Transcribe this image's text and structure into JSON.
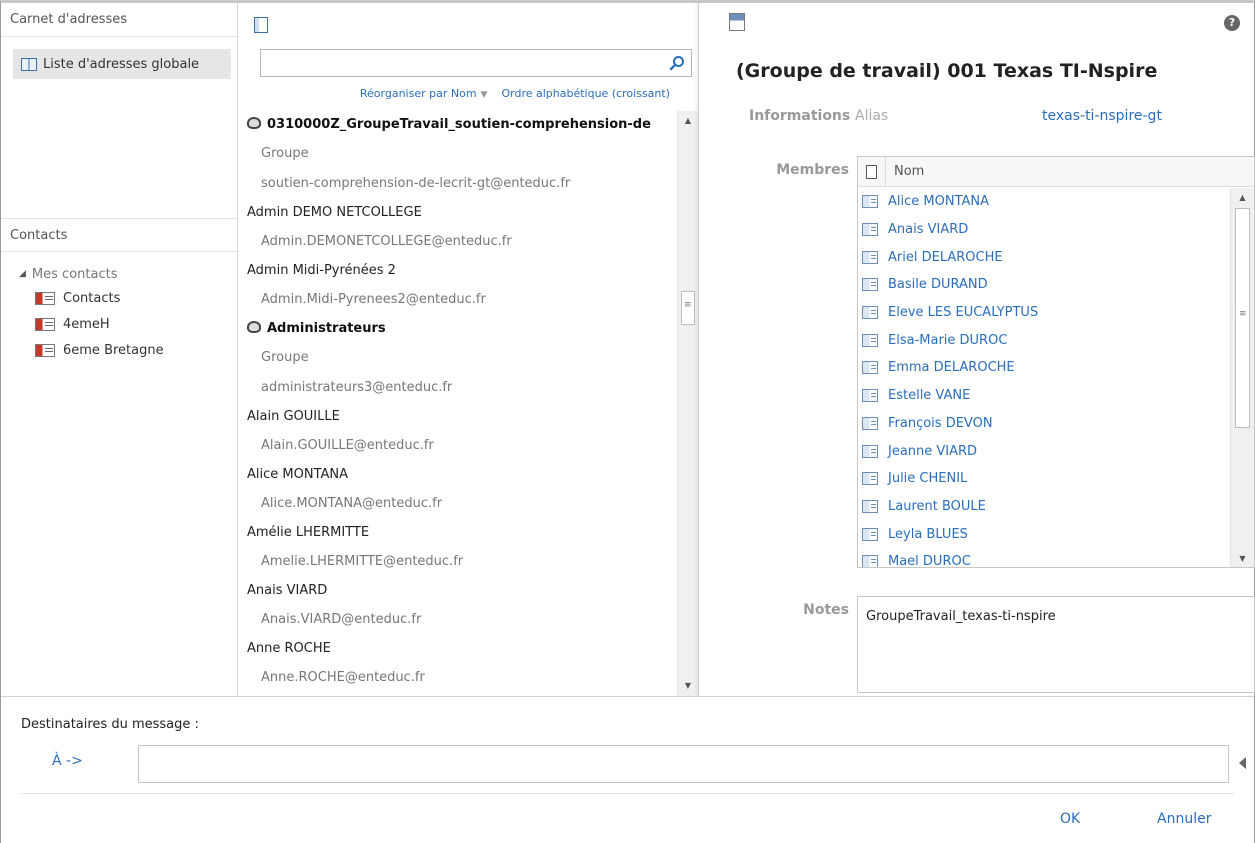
{
  "nav": {
    "address_book_header": "Carnet d'adresses",
    "global_list_label": "Liste d'adresses globale",
    "contacts_header": "Contacts",
    "my_contacts_label": "Mes contacts",
    "contact_folders": [
      "Contacts",
      "4emeH",
      "6eme Bretagne"
    ]
  },
  "list": {
    "search_placeholder": "",
    "sort_by_label": "Réorganiser par Nom",
    "sort_order_label": "Ordre alphabétique (croissant)",
    "entries": [
      {
        "name": "0310000Z_GroupeTravail_soutien-comprehension-de",
        "is_group": true,
        "type": "Groupe",
        "email": "soutien-comprehension-de-lecrit-gt@enteduc.fr"
      },
      {
        "name": "Admin DEMO NETCOLLEGE",
        "is_group": false,
        "email": "Admin.DEMONETCOLLEGE@enteduc.fr"
      },
      {
        "name": "Admin Midi-Pyrénées 2",
        "is_group": false,
        "email": "Admin.Midi-Pyrenees2@enteduc.fr"
      },
      {
        "name": "Administrateurs",
        "is_group": true,
        "type": "Groupe",
        "email": "administrateurs3@enteduc.fr"
      },
      {
        "name": "Alain GOUILLE",
        "is_group": false,
        "email": "Alain.GOUILLE@enteduc.fr"
      },
      {
        "name": "Alice MONTANA",
        "is_group": false,
        "email": "Alice.MONTANA@enteduc.fr"
      },
      {
        "name": "Amélie LHERMITTE",
        "is_group": false,
        "email": "Amelie.LHERMITTE@enteduc.fr"
      },
      {
        "name": "Anais VIARD",
        "is_group": false,
        "email": "Anais.VIARD@enteduc.fr"
      },
      {
        "name": "Anne ROCHE",
        "is_group": false,
        "email": "Anne.ROCHE@enteduc.fr"
      }
    ]
  },
  "detail": {
    "title": "(Groupe de travail) 001 Texas TI-Nspire",
    "info_label": "Informations",
    "alias_label": "Alias",
    "alias_value": "texas-ti-nspire-gt",
    "members_label": "Membres",
    "members_column": "Nom",
    "members": [
      "Alice MONTANA",
      "Anais VIARD",
      "Ariel DELAROCHE",
      "Basile DURAND",
      "Eleve LES EUCALYPTUS",
      "Elsa-Marie DUROC",
      "Emma DELAROCHE",
      "Estelle VANE",
      "François DEVON",
      "Jeanne VIARD",
      "Julie CHENIL",
      "Laurent BOULE",
      "Leyla BLUES",
      "Mael DUROC"
    ],
    "notes_label": "Notes",
    "notes_value": "GroupeTravail_texas-ti-nspire",
    "help_glyph": "?"
  },
  "bottom": {
    "recipients_label": "Destinataires du message :",
    "to_label": "À ->",
    "to_value": "",
    "ok_label": "OK",
    "cancel_label": "Annuler"
  },
  "colors": {
    "link": "#2a6ebb",
    "label_gray": "#999999",
    "selection": "#e6e6e6"
  }
}
